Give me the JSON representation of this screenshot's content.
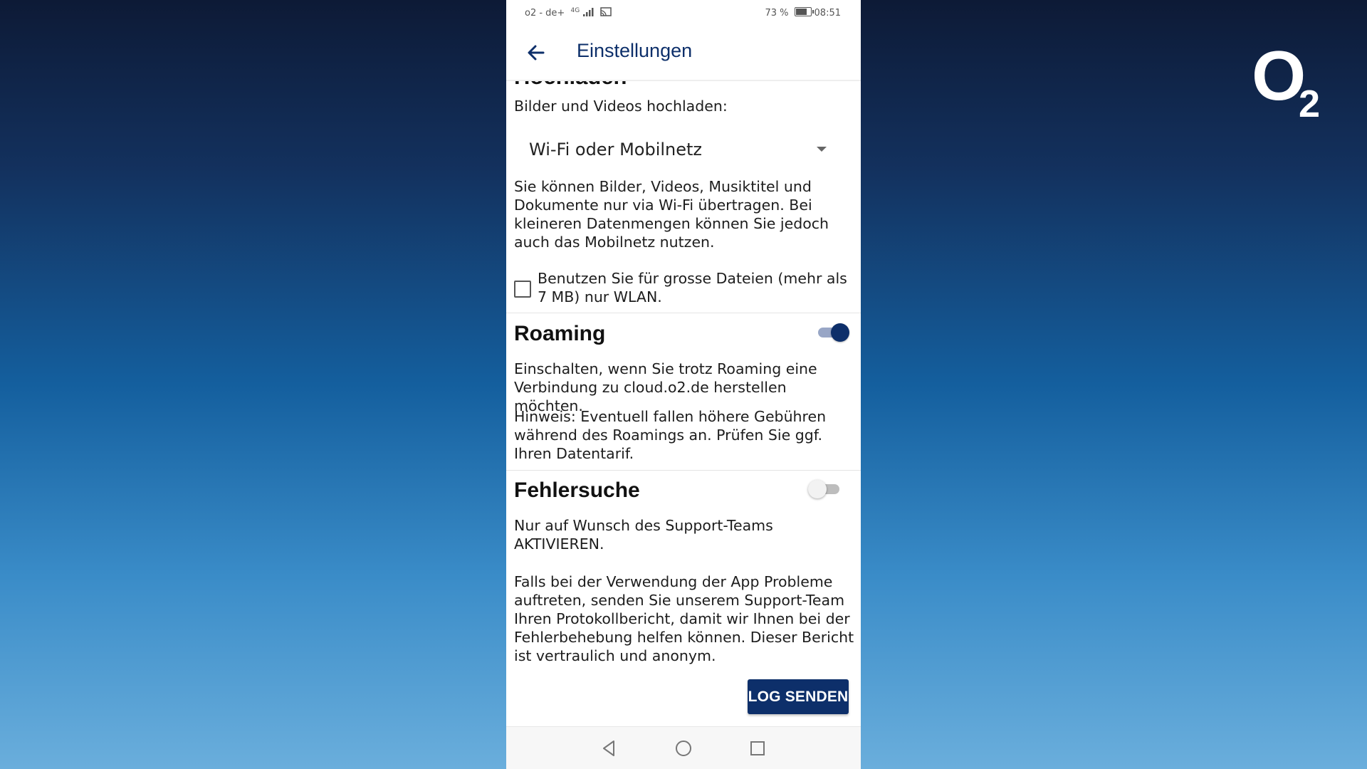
{
  "brand": {
    "logo_main": "O",
    "logo_sub": "2"
  },
  "status_bar": {
    "carrier": "o2 - de+",
    "network": "4G",
    "battery": "73 %",
    "time": "08:51"
  },
  "app_bar": {
    "title": "Einstellungen"
  },
  "upload": {
    "section_title": "Hochladen",
    "label": "Bilder und Videos hochladen:",
    "dropdown_value": "Wi-Fi oder Mobilnetz",
    "description": "Sie können Bilder, Videos, Musiktitel und Dokumente nur via Wi-Fi übertragen. Bei kleineren Datenmengen können Sie jedoch auch das Mobilnetz nutzen.",
    "checkbox_label": "Benutzen Sie für grosse Dateien (mehr als 7 MB) nur WLAN.",
    "checkbox_checked": false
  },
  "roaming": {
    "title": "Roaming",
    "enabled": true,
    "description": "Einschalten, wenn Sie trotz Roaming eine Verbindung zu cloud.o2.de herstellen möchten.",
    "hint": "Hinweis: Eventuell fallen höhere Gebühren während des Roamings an. Prüfen Sie ggf. Ihren Datentarif."
  },
  "debugging": {
    "title": "Fehlersuche",
    "enabled": false,
    "description": "Nur auf Wunsch des Support-Teams AKTIVIEREN.",
    "details": "Falls bei der Verwendung der App Probleme auftreten, senden Sie unserem Support-Team Ihren Protokollbericht, damit wir Ihnen bei der Fehlerbehebung helfen können. Dieser Bericht ist vertraulich und anonym.",
    "button_label": "LOG SENDEN"
  },
  "colors": {
    "accent": "#0d2f6a",
    "text": "#1d1d1d"
  },
  "icons": {
    "back": "arrow-left-icon",
    "nav_back": "triangle-back-icon",
    "nav_home": "circle-home-icon",
    "nav_recents": "square-recents-icon"
  }
}
